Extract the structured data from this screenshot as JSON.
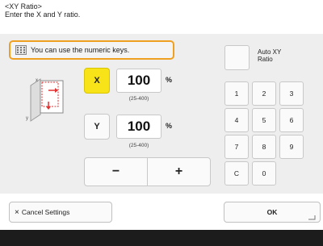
{
  "header": {
    "title": "<XY Ratio>",
    "instruction": "Enter the X and Y ratio."
  },
  "hint": {
    "text": "You can use the numeric keys.",
    "icon": "keypad-icon",
    "border_color": "#f0a020"
  },
  "x_field": {
    "label": "X",
    "value": "100",
    "unit": "%",
    "range": "(25-400)",
    "active_color": "#f7e318"
  },
  "y_field": {
    "label": "Y",
    "value": "100",
    "unit": "%",
    "range": "(25-400)"
  },
  "adjust": {
    "minus": "−",
    "plus": "+"
  },
  "auto_xy": {
    "label": "Auto XY Ratio"
  },
  "keypad": {
    "k1": "1",
    "k2": "2",
    "k3": "3",
    "k4": "4",
    "k5": "5",
    "k6": "6",
    "k7": "7",
    "k8": "8",
    "k9": "9",
    "clear": "C",
    "k0": "0"
  },
  "footer": {
    "cancel_label": "Cancel Settings",
    "ok_label": "OK"
  }
}
